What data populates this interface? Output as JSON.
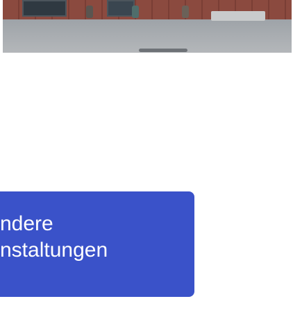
{
  "photo": {
    "description_icon": "photo-image"
  },
  "more_events_button": {
    "line1": "ndere",
    "line2": "nstaltungen",
    "background_color": "#3a52c9",
    "text_color": "#ffffff"
  }
}
